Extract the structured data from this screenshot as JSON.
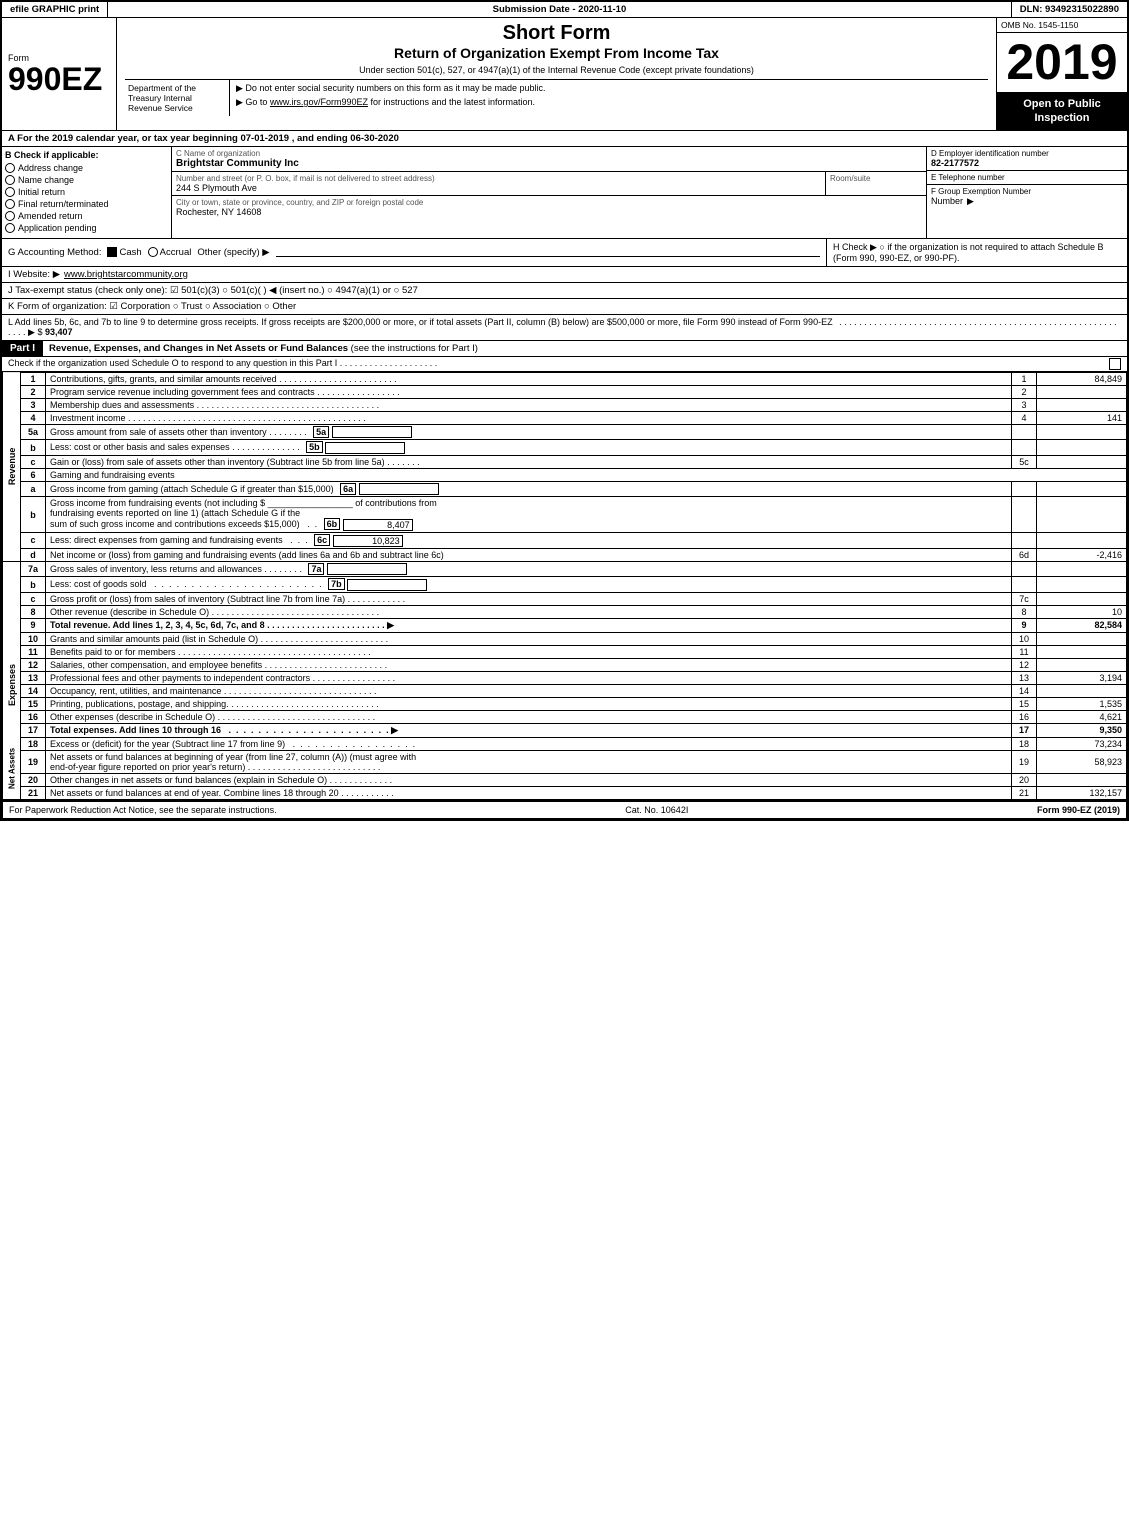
{
  "header": {
    "efile_label": "efile GRAPHIC print",
    "submission_date_label": "Submission Date - 2020-11-10",
    "dln_label": "DLN: 93492315022890",
    "omb_label": "OMB No. 1545-1150",
    "form_number": "990EZ",
    "short_form": "Short Form",
    "return_title": "Return of Organization Exempt From Income Tax",
    "subtitle": "Under section 501(c), 527, or 4947(a)(1) of the Internal Revenue Code (except private foundations)",
    "notice1": "▶ Do not enter social security numbers on this form as it may be made public.",
    "notice2": "▶ Go to www.irs.gov/Form990EZ for instructions and the latest information.",
    "year": "2019",
    "open_to_public": "Open to Public Inspection"
  },
  "dept": {
    "name": "Department of the Treasury Internal Revenue Service"
  },
  "section_a": {
    "text": "A  For the 2019 calendar year, or tax year beginning 07-01-2019 , and ending 06-30-2020"
  },
  "section_b": {
    "label": "B  Check if applicable:",
    "items": [
      {
        "label": "Address change",
        "checked": false
      },
      {
        "label": "Name change",
        "checked": false
      },
      {
        "label": "Initial return",
        "checked": false
      },
      {
        "label": "Final return/terminated",
        "checked": false
      },
      {
        "label": "Amended return",
        "checked": false
      },
      {
        "label": "Application pending",
        "checked": false
      }
    ]
  },
  "org": {
    "c_label": "C Name of organization",
    "name": "Brightstar Community Inc",
    "address_label": "Number and street (or P. O. box, if mail is not delivered to street address)",
    "address": "244 S Plymouth Ave",
    "room_label": "Room/suite",
    "room": "",
    "city_label": "City or town, state or province, country, and ZIP or foreign postal code",
    "city": "Rochester, NY  14608",
    "d_label": "D Employer identification number",
    "ein": "82-2177572",
    "e_label": "E Telephone number",
    "phone": "",
    "f_label": "F Group Exemption Number",
    "group_num": ""
  },
  "accounting": {
    "g_label": "G Accounting Method:",
    "cash_label": "Cash",
    "cash_checked": true,
    "accrual_label": "Accrual",
    "accrual_checked": false,
    "other_label": "Other (specify) ▶"
  },
  "h_check": {
    "label": "H  Check ▶  ○ if the organization is not required to attach Schedule B (Form 990, 990-EZ, or 990-PF)."
  },
  "website": {
    "label": "I Website: ▶",
    "url": "www.brightstarcommunity.org"
  },
  "tax_status": {
    "label": "J Tax-exempt status (check only one):",
    "options": "☑ 501(c)(3) ○ 501(c)(  ) ◀ (insert no.) ○ 4947(a)(1) or ○ 527"
  },
  "form_of_org": {
    "label": "K Form of organization:",
    "options": "☑ Corporation  ○ Trust  ○ Association  ○ Other"
  },
  "line_l": {
    "text": "L Add lines 5b, 6c, and 7b to line 9 to determine gross receipts. If gross receipts are $200,000 or more, or if total assets (Part II, column (B) below) are $500,000 or more, file Form 990 instead of Form 990-EZ",
    "amount_label": "▶ $",
    "amount": "93,407"
  },
  "part1": {
    "title": "Part I",
    "subtitle": "Revenue, Expenses, and Changes in Net Assets or Fund Balances",
    "see_instructions": "(see the instructions for Part I)",
    "schedule_o_check": "Check if the organization used Schedule O to respond to any question in this Part I . . . . . . . . . . . . . . . . . . . .",
    "rows": [
      {
        "num": "1",
        "desc": "Contributions, gifts, grants, and similar amounts received . . . . . . . . . . . . . . . . . . . . . . . .",
        "line": "1",
        "amount": "84,849"
      },
      {
        "num": "2",
        "desc": "Program service revenue including government fees and contracts . . . . . . . . . . . . . . . . .",
        "line": "2",
        "amount": ""
      },
      {
        "num": "3",
        "desc": "Membership dues and assessments . . . . . . . . . . . . . . . . . . . . . . . . . . . . . . . . . . . . .",
        "line": "3",
        "amount": ""
      },
      {
        "num": "4",
        "desc": "Investment income . . . . . . . . . . . . . . . . . . . . . . . . . . . . . . . . . . . . . . . . . . . . . . . .",
        "line": "4",
        "amount": "141"
      },
      {
        "num": "5a",
        "desc": "Gross amount from sale of assets other than inventory . . . . . . .",
        "subline": "5a",
        "subamount": ""
      },
      {
        "num": "5b",
        "desc": "Less: cost or other basis and sales expenses . . . . . . . . . . . . . .",
        "subline": "5b",
        "subamount": ""
      },
      {
        "num": "5c",
        "desc": "Gain or (loss) from sale of assets other than inventory (Subtract line 5b from line 5a) . . . . . . .",
        "line": "5c",
        "amount": ""
      },
      {
        "num": "6",
        "desc": "Gaming and fundraising events",
        "line": "",
        "amount": ""
      },
      {
        "num": "6a",
        "desc": "Gross income from gaming (attach Schedule G if greater than $15,000)",
        "subline": "6a",
        "subamount": ""
      },
      {
        "num": "6b",
        "desc": "Gross income from fundraising events (not including $ _____________ of contributions from fundraising events reported on line 1) (attach Schedule G if the sum of such gross income and contributions exceeds $15,000) . .",
        "subline": "6b",
        "subamount": "8,407"
      },
      {
        "num": "6c",
        "desc": "Less: direct expenses from gaming and fundraising events . . .",
        "subline": "6c",
        "subamount": "10,823"
      },
      {
        "num": "6d",
        "desc": "Net income or (loss) from gaming and fundraising events (add lines 6a and 6b and subtract line 6c)",
        "line": "6d",
        "amount": "-2,416"
      },
      {
        "num": "7a",
        "desc": "Gross sales of inventory, less returns and allowances . . . . . . . .",
        "subline": "7a",
        "subamount": ""
      },
      {
        "num": "7b",
        "desc": "Less: cost of goods sold . . . . . . . . . . . . . . . . . . . . . . . . . . . .",
        "subline": "7b",
        "subamount": ""
      },
      {
        "num": "7c",
        "desc": "Gross profit or (loss) from sales of inventory (Subtract line 7b from line 7a) . . . . . . . . . . . .",
        "line": "7c",
        "amount": ""
      },
      {
        "num": "8",
        "desc": "Other revenue (describe in Schedule O) . . . . . . . . . . . . . . . . . . . . . . . . . . . . . . . . . .",
        "line": "8",
        "amount": "10"
      },
      {
        "num": "9",
        "desc": "Total revenue. Add lines 1, 2, 3, 4, 5c, 6d, 7c, and 8 . . . . . . . . . . . . . . . . . . . . . . . . ▶",
        "line": "9",
        "amount": "82,584",
        "bold": true
      }
    ]
  },
  "expenses": {
    "rows": [
      {
        "num": "10",
        "desc": "Grants and similar amounts paid (list in Schedule O) . . . . . . . . . . . . . . . . . . . . . . . . . .",
        "line": "10",
        "amount": ""
      },
      {
        "num": "11",
        "desc": "Benefits paid to or for members . . . . . . . . . . . . . . . . . . . . . . . . . . . . . . . . . . . . . . .",
        "line": "11",
        "amount": ""
      },
      {
        "num": "12",
        "desc": "Salaries, other compensation, and employee benefits . . . . . . . . . . . . . . . . . . . . . . . . .",
        "line": "12",
        "amount": ""
      },
      {
        "num": "13",
        "desc": "Professional fees and other payments to independent contractors . . . . . . . . . . . . . . . . .",
        "line": "13",
        "amount": "3,194"
      },
      {
        "num": "14",
        "desc": "Occupancy, rent, utilities, and maintenance . . . . . . . . . . . . . . . . . . . . . . . . . . . . . . .",
        "line": "14",
        "amount": ""
      },
      {
        "num": "15",
        "desc": "Printing, publications, postage, and shipping. . . . . . . . . . . . . . . . . . . . . . . . . . . . . . .",
        "line": "15",
        "amount": "1,535"
      },
      {
        "num": "16",
        "desc": "Other expenses (describe in Schedule O) . . . . . . . . . . . . . . . . . . . . . . . . . . . . . . . .",
        "line": "16",
        "amount": "4,621"
      },
      {
        "num": "17",
        "desc": "Total expenses. Add lines 10 through 16 . . . . . . . . . . . . . . . . . . . . . . . . . . . . . . . ▶",
        "line": "17",
        "amount": "9,350",
        "bold": true
      }
    ]
  },
  "net_assets": {
    "rows": [
      {
        "num": "18",
        "desc": "Excess or (deficit) for the year (Subtract line 17 from line 9) . . . . . . . . . . . . . . . . . . .",
        "line": "18",
        "amount": "73,234"
      },
      {
        "num": "19",
        "desc": "Net assets or fund balances at beginning of year (from line 27, column (A)) (must agree with end-of-year figure reported on prior year's return) . . . . . . . . . . . . . . . . . . . . . . . . . . .",
        "line": "19",
        "amount": "58,923"
      },
      {
        "num": "20",
        "desc": "Other changes in net assets or fund balances (explain in Schedule O) . . . . . . . . . . . . .",
        "line": "20",
        "amount": ""
      },
      {
        "num": "21",
        "desc": "Net assets or fund balances at end of year. Combine lines 18 through 20 . . . . . . . . . . .",
        "line": "21",
        "amount": "132,157"
      }
    ]
  },
  "footer": {
    "paperwork_text": "For Paperwork Reduction Act Notice, see the separate instructions.",
    "cat_num": "Cat. No. 10642I",
    "form_label": "Form 990-EZ (2019)"
  }
}
